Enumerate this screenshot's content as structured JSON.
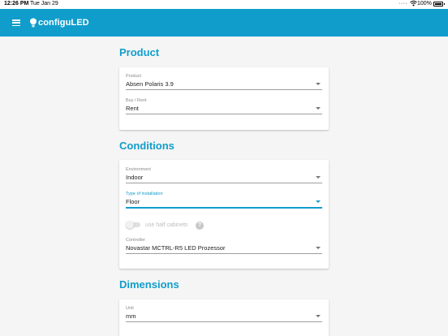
{
  "status_bar": {
    "time": "12:26 PM",
    "date": "Tue Jan 29",
    "battery": "100%",
    "icons": [
      "signal-dots-icon",
      "wifi-icon",
      "battery-icon"
    ]
  },
  "app_bar": {
    "title": "configuLED",
    "color": "#109dcc",
    "icons": [
      "menu-icon",
      "bulb-logo-icon"
    ]
  },
  "sections": {
    "product": {
      "title": "Product",
      "product_field": {
        "label": "Product",
        "value": "Absen Polaris 3.9"
      },
      "buy_rent_field": {
        "label": "Buy / Rent",
        "value": "Rent"
      }
    },
    "conditions": {
      "title": "Conditions",
      "environment_field": {
        "label": "Environment",
        "value": "Indoor"
      },
      "installation_field": {
        "label": "Type of installation",
        "value": "Floor"
      },
      "half_cabinets_toggle": {
        "label": "use half cabinets",
        "on": false,
        "enabled": false
      },
      "help": "?",
      "controller_field": {
        "label": "Controller",
        "value": "Novastar MCTRL-R5 LED Prozessor"
      }
    },
    "dimensions": {
      "title": "Dimensions",
      "unit_field": {
        "label": "Unit",
        "value": "mm"
      }
    }
  }
}
